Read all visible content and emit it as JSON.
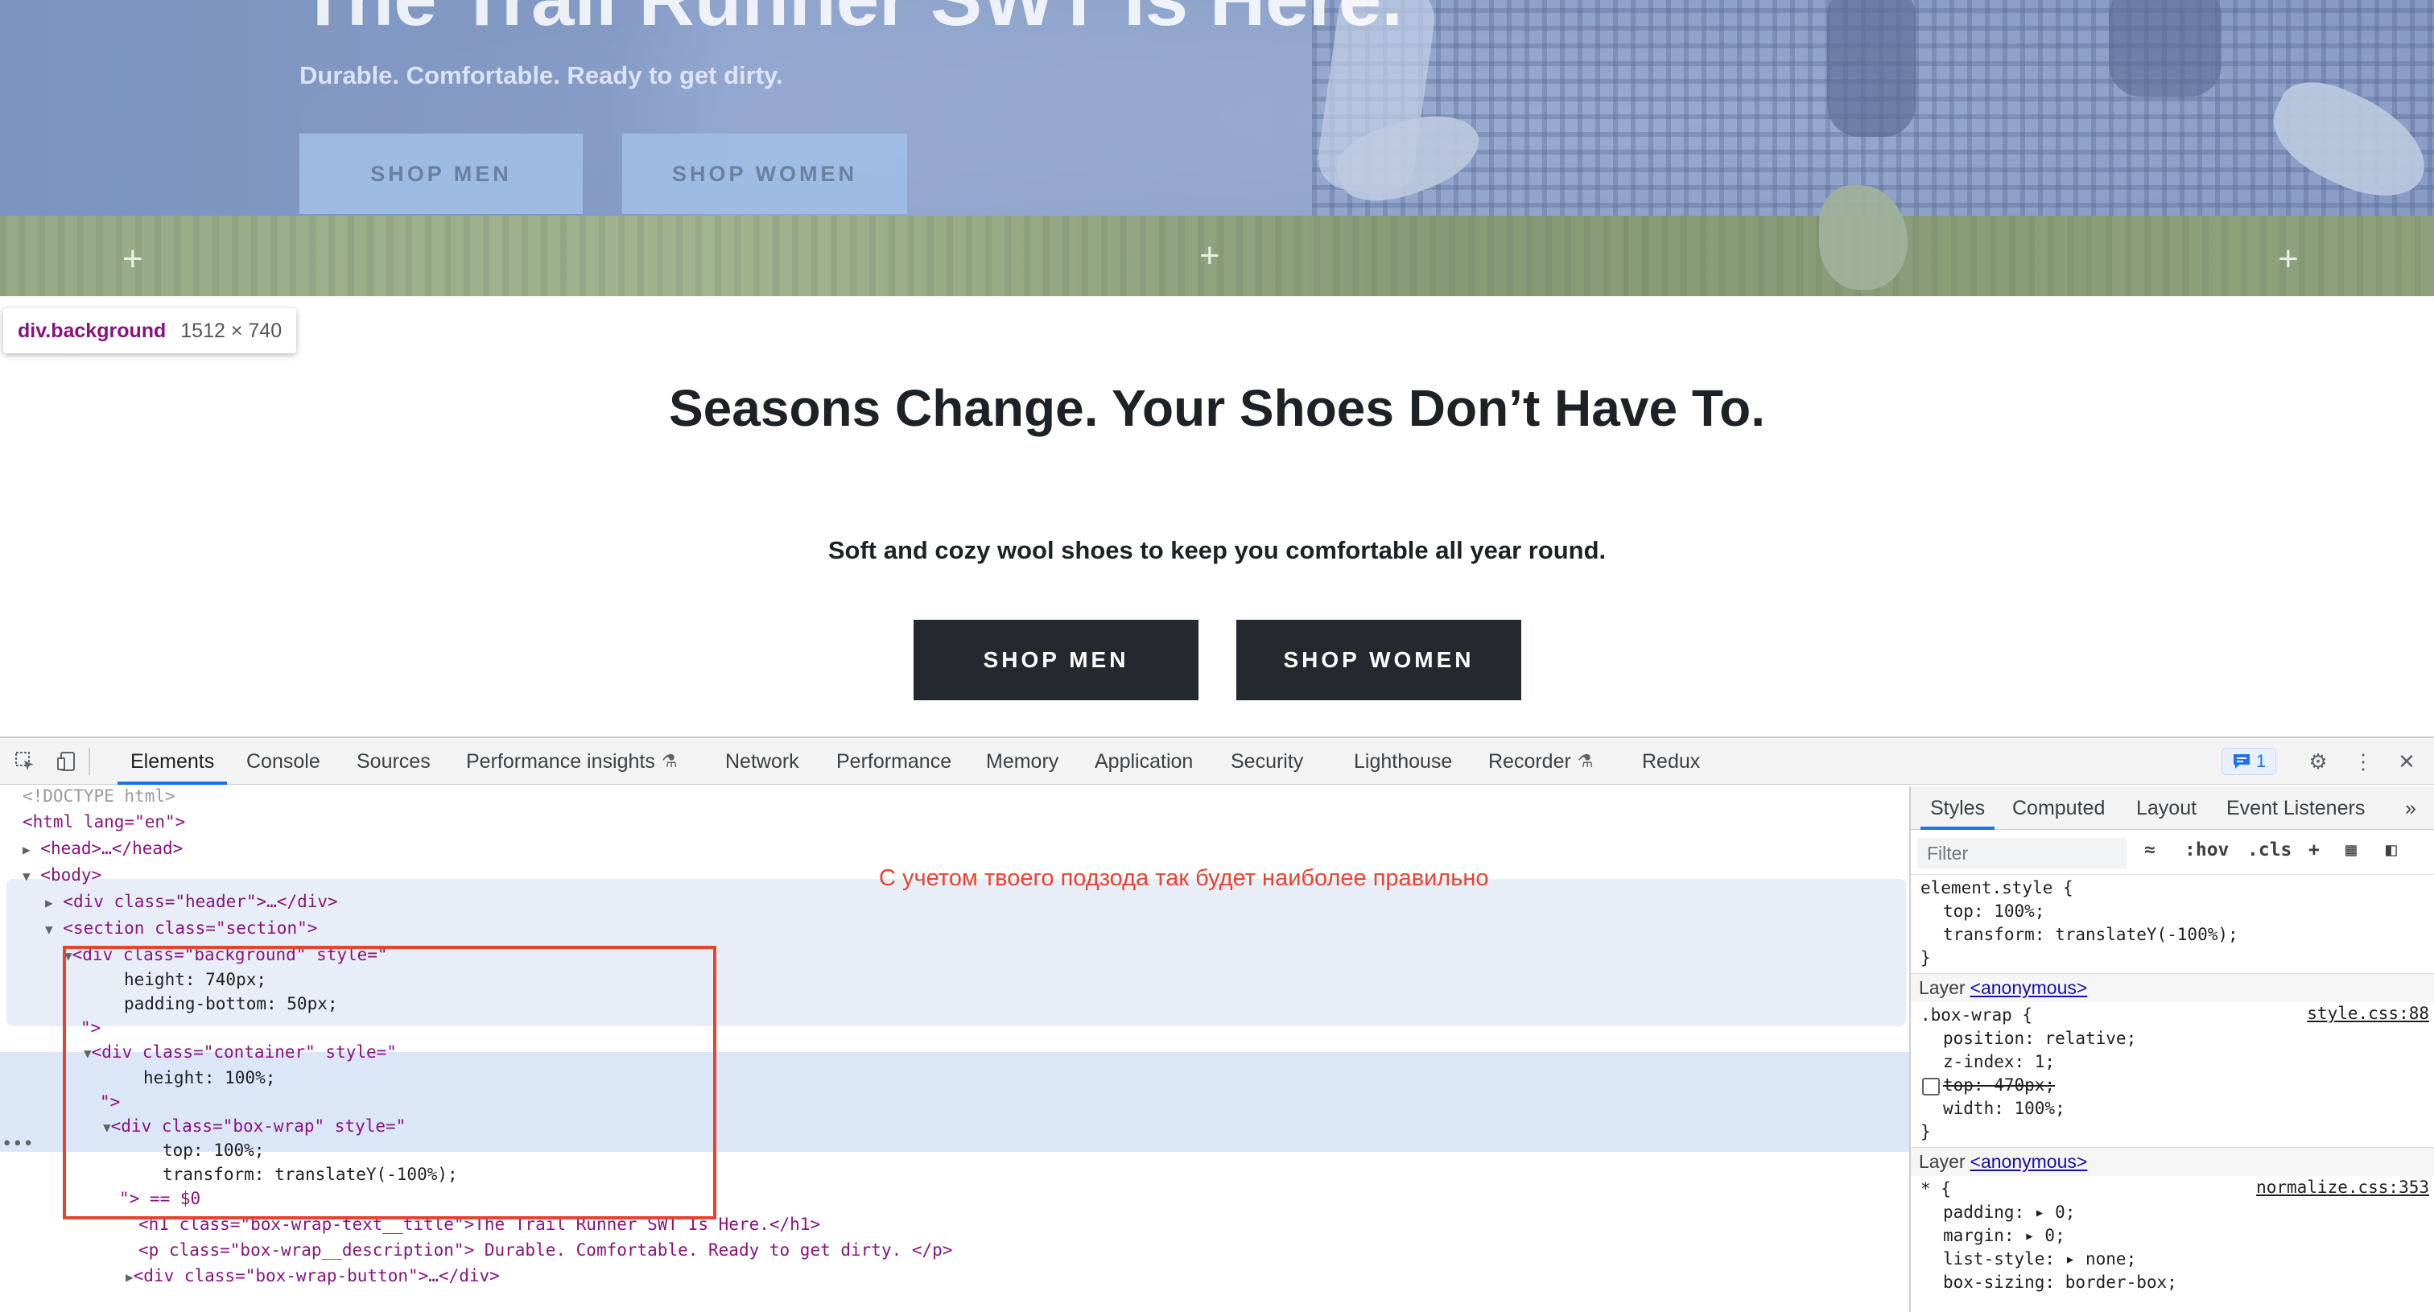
{
  "hero": {
    "title": "The Trail Runner SWT Is Here.",
    "description": "Durable. Comfortable. Ready to get dirty.",
    "btn_men": "SHOP MEN",
    "btn_women": "SHOP WOMEN"
  },
  "inspect_tooltip": {
    "tag": "div",
    "class": ".background",
    "dims": "1512 × 740"
  },
  "section": {
    "title": "Seasons Change. Your Shoes Don’t Have To.",
    "subtitle": "Soft and cozy wool shoes to keep you comfortable all year round.",
    "btn_men": "SHOP MEN",
    "btn_women": "SHOP WOMEN"
  },
  "devtools": {
    "tabs": [
      "Elements",
      "Console",
      "Sources",
      "Performance insights",
      "Network",
      "Performance",
      "Memory",
      "Application",
      "Security",
      "Lighthouse",
      "Recorder",
      "Redux"
    ],
    "issues_count": "1",
    "note": "С учетом твоего подзода так будет наиболее правильно",
    "dom": {
      "doctype": "<!DOCTYPE html>",
      "html_open": "<html lang=\"en\">",
      "head": "<head>…</head>",
      "body_open": "<body>",
      "header_div": "<div class=\"header\">…</div>",
      "section_open": "<section class=\"section\">",
      "bg_open": "<div class=\"background\" style=\"",
      "bg_height": "height: 740px;",
      "bg_padding": "padding-bottom: 50px;",
      "close_quote": "\">",
      "container_open": "<div class=\"container\" style=\"",
      "container_height": "height: 100%;",
      "boxwrap_open": "<div class=\"box-wrap\" style=\"",
      "boxwrap_top": "top: 100%;",
      "boxwrap_transform": "transform: translateY(-100%);",
      "boxwrap_close": "\"> == $0",
      "h1_line": "<h1 class=\"box-wrap-text__title\">The Trail Runner SWT Is Here.</h1>",
      "p_line": "<p class=\"box-wrap__description\"> Durable. Comfortable. Ready to get dirty. </p>",
      "btn_div": "<div class=\"box-wrap-button\">…</div>"
    },
    "styles": {
      "tabs": [
        "Styles",
        "Computed",
        "Layout",
        "Event Listeners"
      ],
      "filter_placeholder": "Filter",
      "hov": ":hov",
      "cls": ".cls",
      "element_style_selector": "element.style {",
      "es_top": "top: 100%;",
      "es_transform": "transform: translateY(-100%);",
      "close_brace": "}",
      "layer_label": "Layer",
      "layer_link": "<anonymous>",
      "boxwrap_selector": ".box-wrap {",
      "boxwrap_src": "style.css:88",
      "bw_position": "position: relative;",
      "bw_zindex": "z-index: 1;",
      "bw_top": "top: 470px;",
      "bw_width": "width: 100%;",
      "universal_selector": "* {",
      "universal_src": "normalize.css:353",
      "u_padding": "padding: ▸ 0;",
      "u_margin": "margin: ▸ 0;",
      "u_liststyle": "list-style: ▸ none;",
      "u_boxsizing": "box-sizing: border-box;"
    }
  }
}
